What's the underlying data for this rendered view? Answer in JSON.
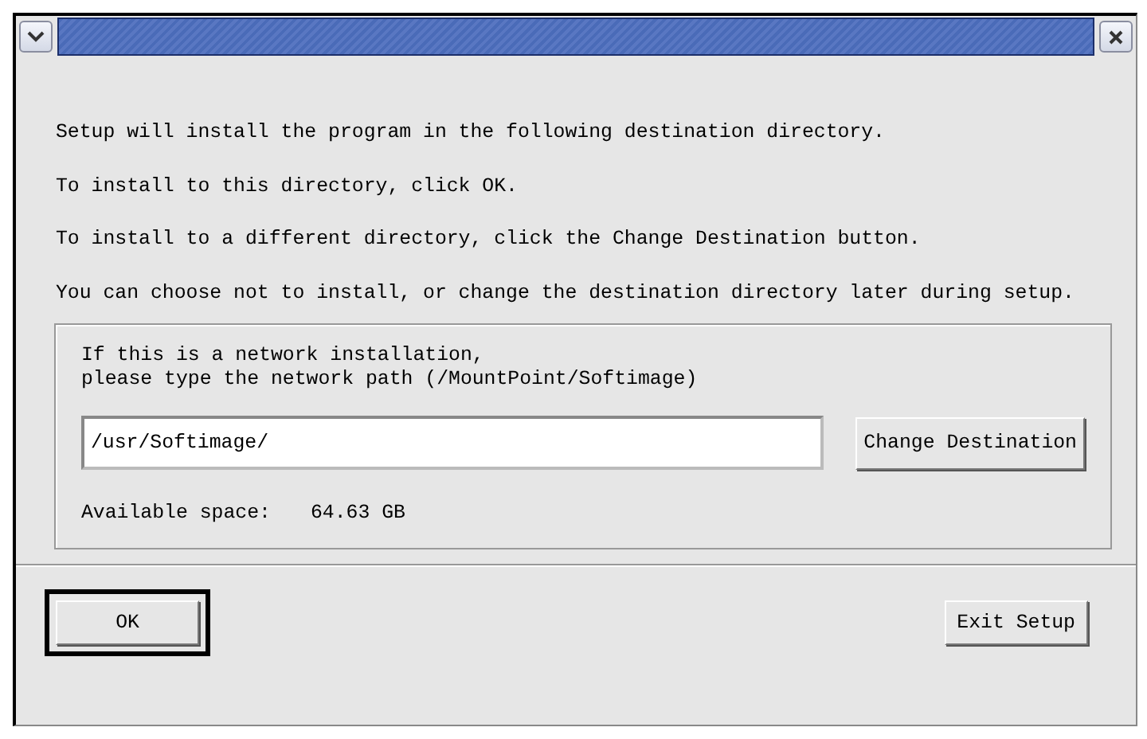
{
  "messages": [
    "Setup will install the program in the following destination directory.",
    "To install to this directory, click OK.",
    "To install to a different directory, click the Change Destination button.",
    "You can choose not to install, or change the destination directory later during setup."
  ],
  "destination": {
    "prompt_lines": [
      "If this is a network installation,",
      "please type the network path (/MountPoint/Softimage)"
    ],
    "path": "/usr/Softimage/",
    "change_button": "Change Destination",
    "space_label": "Available space:",
    "space_value": "64.63 GB"
  },
  "buttons": [
    {
      "label": "OK",
      "default": true
    },
    {
      "label": "Exit Setup",
      "default": false
    }
  ]
}
